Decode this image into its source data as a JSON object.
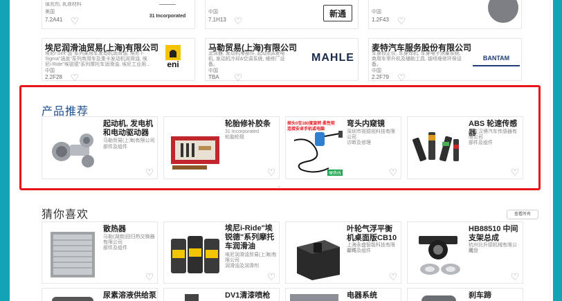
{
  "top_row": [
    {
      "desc_1": "填充剂, 乳液材料",
      "meta": "美国",
      "code": "7.2A41",
      "logo": "31 Incorporated"
    },
    {
      "meta": "中国",
      "code": "7.1H13",
      "logo": "新通"
    },
    {
      "meta": "中国",
      "code": "1.2F43"
    }
  ],
  "companies": [
    {
      "name": "埃尼润滑油贸易(上海)有限公司",
      "desc": "埃尼i-Sint\"品\"系列乘用车发动机润滑油, 埃尼 i-Sigma\"涵盖\"系列商用车及重卡发动机润滑油, 埃尼i-Ride\"埃锐德\"系列摩托车润滑油, 埃尼工业用...",
      "country": "中国",
      "code": "2.2F28",
      "logo_text": "eni"
    },
    {
      "name": "马勒贸易(上海)有限公司",
      "desc": "滤清器, 发动机零部件, 起动机&发电机, 发动机冷却&空调系统, 维修厂设备。",
      "country": "中国",
      "code": "TBA",
      "logo_text": "MAHLE"
    },
    {
      "name": "麦特汽车服务股份有限公司",
      "desc": "车身校正仪, 车身焊机, 车身电子测量系统, 商用车举升机及辅助工具, 钣喷维修环保设备。",
      "country": "中国",
      "code": "2.2F79",
      "logo_text": "BANTAM"
    }
  ],
  "recommend": {
    "title": "产品推荐",
    "products": [
      {
        "name": "起动机, 发电机和电动驱动器",
        "sub_1": "马勒贸易(上海)有限公司",
        "sub_2": "部件及组件"
      },
      {
        "name": "轮胎修补胶条",
        "sub_1": "31 Incorporated",
        "sub_2": "轮胎轮毂"
      },
      {
        "name": "弯头内窥镜",
        "sub_1": "深圳市视德视科技有限公司",
        "sub_2": "诊断及修理",
        "banner_1": "探头0至180度旋转 柔性软",
        "banner_2": "连接安卓手机或电脑",
        "banner_3": "硬质线"
      },
      {
        "name": "ABS 轮速传感器",
        "sub_1": "浙江汉博汽车传感器有限公司",
        "sub_2": "部件及组件"
      }
    ]
  },
  "guess": {
    "title": "猜你喜欢",
    "view_all": "查看所有",
    "products": [
      {
        "name": "散热器",
        "sub_1": "马勒(湖南)回归热交换器有限公司",
        "sub_2": "部件及组件"
      },
      {
        "name": "埃尼i-Ride\"埃锐德\"系列摩托车润滑油",
        "sub_1": "埃尼润滑油贸易(上海)有限公司",
        "sub_2": "润滑油及润滑剂"
      },
      {
        "name": "叶轮气浮平衡机桌面版CB10",
        "sub_1": "上海永盛智能科技有限公司",
        "sub_2": "部件及组件"
      },
      {
        "name": "HB88510 中间支架总成",
        "sub_1": "杭州比升德机械有限公司",
        "sub_2": "底盘"
      }
    ],
    "bottom_row": [
      "尿素溶液供给泵",
      "DV1清漆喷枪",
      "电器系统",
      "刹车蹄"
    ]
  }
}
